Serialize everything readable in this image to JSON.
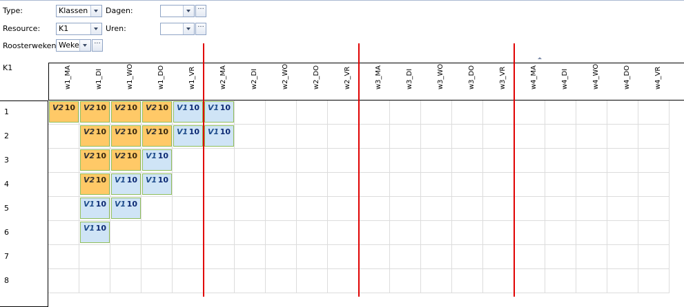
{
  "filters": {
    "type_label": "Type:",
    "type_value": "Klassen",
    "resource_label": "Resource:",
    "resource_value": "K1",
    "dagen_label": "Dagen:",
    "dagen_value": "",
    "uren_label": "Uren:",
    "uren_value": "",
    "roosterweken_label": "Roosterweken:",
    "roosterweken_value": "Weker",
    "ellipsis": "···"
  },
  "grid": {
    "corner_label": "K1",
    "columns": [
      "w1_MA",
      "w1_DI",
      "w1_WO",
      "w1_DO",
      "w1_VR",
      "w2_MA",
      "w2_DI",
      "w2_WO",
      "w2_DO",
      "w2_VR",
      "w3_MA",
      "w3_DI",
      "w3_WO",
      "w3_DO",
      "w3_VR",
      "w4_MA",
      "w4_DI",
      "w4_WO",
      "w4_DO",
      "w4_VR"
    ],
    "rows": [
      "1",
      "2",
      "3",
      "4",
      "5",
      "6",
      "7",
      "8"
    ],
    "blocks": [
      {
        "row": 0,
        "col": 0,
        "code": "V2",
        "value": "10",
        "kind": "v2"
      },
      {
        "row": 0,
        "col": 1,
        "code": "V2",
        "value": "10",
        "kind": "v2"
      },
      {
        "row": 0,
        "col": 2,
        "code": "V2",
        "value": "10",
        "kind": "v2"
      },
      {
        "row": 0,
        "col": 3,
        "code": "V2",
        "value": "10",
        "kind": "v2"
      },
      {
        "row": 0,
        "col": 4,
        "code": "V1",
        "value": "10",
        "kind": "v1"
      },
      {
        "row": 0,
        "col": 5,
        "code": "V1",
        "value": "10",
        "kind": "v1"
      },
      {
        "row": 1,
        "col": 1,
        "code": "V2",
        "value": "10",
        "kind": "v2"
      },
      {
        "row": 1,
        "col": 2,
        "code": "V2",
        "value": "10",
        "kind": "v2"
      },
      {
        "row": 1,
        "col": 3,
        "code": "V2",
        "value": "10",
        "kind": "v2"
      },
      {
        "row": 1,
        "col": 4,
        "code": "V1",
        "value": "10",
        "kind": "v1"
      },
      {
        "row": 1,
        "col": 5,
        "code": "V1",
        "value": "10",
        "kind": "v1"
      },
      {
        "row": 2,
        "col": 1,
        "code": "V2",
        "value": "10",
        "kind": "v2"
      },
      {
        "row": 2,
        "col": 2,
        "code": "V2",
        "value": "10",
        "kind": "v2"
      },
      {
        "row": 2,
        "col": 3,
        "code": "V1",
        "value": "10",
        "kind": "v1"
      },
      {
        "row": 3,
        "col": 1,
        "code": "V2",
        "value": "10",
        "kind": "v2"
      },
      {
        "row": 3,
        "col": 2,
        "code": "V1",
        "value": "10",
        "kind": "v1"
      },
      {
        "row": 3,
        "col": 3,
        "code": "V1",
        "value": "10",
        "kind": "v1"
      },
      {
        "row": 4,
        "col": 1,
        "code": "V1",
        "value": "10",
        "kind": "v1"
      },
      {
        "row": 4,
        "col": 2,
        "code": "V1",
        "value": "10",
        "kind": "v1"
      },
      {
        "row": 5,
        "col": 1,
        "code": "V1",
        "value": "10",
        "kind": "v1"
      }
    ],
    "week_separator_color": "#e00000",
    "v2_color": "#ffc967",
    "v1_color": "#cfe4f6"
  }
}
